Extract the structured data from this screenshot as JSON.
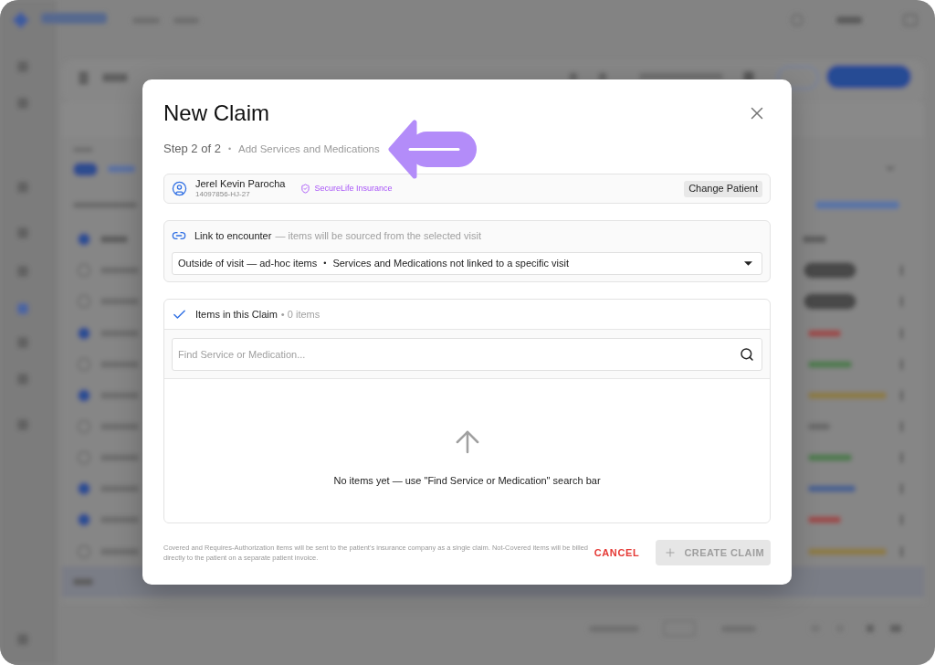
{
  "dialog": {
    "title": "New Claim",
    "step": {
      "label": "Step 2 of 2",
      "separator": "•",
      "name": "Add Services and Medications"
    },
    "patient": {
      "name": "Jerel Kevin Parocha",
      "id": "14097856-HJ-27",
      "insurance": "SecureLife Insurance",
      "change_button": "Change Patient"
    },
    "encounter": {
      "label": "Link to encounter",
      "hint": "— items will be sourced from the selected visit",
      "select": {
        "value": "Outside of visit — ad-hoc items",
        "separator": "•",
        "detail": "Services and Medications not linked to a specific visit"
      }
    },
    "items": {
      "title": "Items in this Claim",
      "count": "• 0 items",
      "search": {
        "placeholder": "Find Service or Medication..."
      },
      "empty_message": "No items yet — use \"Find Service or Medication\" search bar"
    },
    "footer_note": "Covered and Requires-Authorization items will be sent to the patient's insurance company as a single claim. Not-Covered items will be billed directly to the patient on a separate patient invoice.",
    "buttons": [
      {
        "label": "CANCEL",
        "kind": "text",
        "disabled": false
      },
      {
        "label": "CREATE CLAIM",
        "kind": "primary",
        "disabled": true
      }
    ]
  }
}
